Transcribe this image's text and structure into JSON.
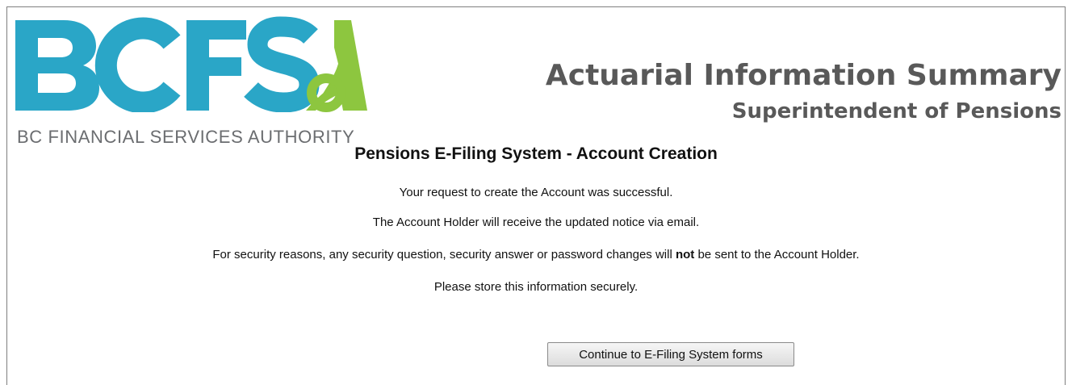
{
  "logo": {
    "wordmark": "BCFSA",
    "subtitle": "BC FINANCIAL SERVICES AUTHORITY",
    "colors": {
      "blue": "#2aa6c7",
      "green": "#8dc63f"
    }
  },
  "header": {
    "title": "Actuarial Information Summary",
    "subtitle": "Superintendent of Pensions"
  },
  "main": {
    "heading": "Pensions E-Filing System - Account Creation",
    "line1": "Your request to create the Account was successful.",
    "line2": "The Account Holder will receive the updated notice via email.",
    "line3_before": "For security reasons, any security question, security answer or password changes will ",
    "line3_bold": "not",
    "line3_after": " be sent to the Account Holder.",
    "line4": "Please store this information securely."
  },
  "actions": {
    "continue_label": "Continue to E-Filing System forms"
  }
}
